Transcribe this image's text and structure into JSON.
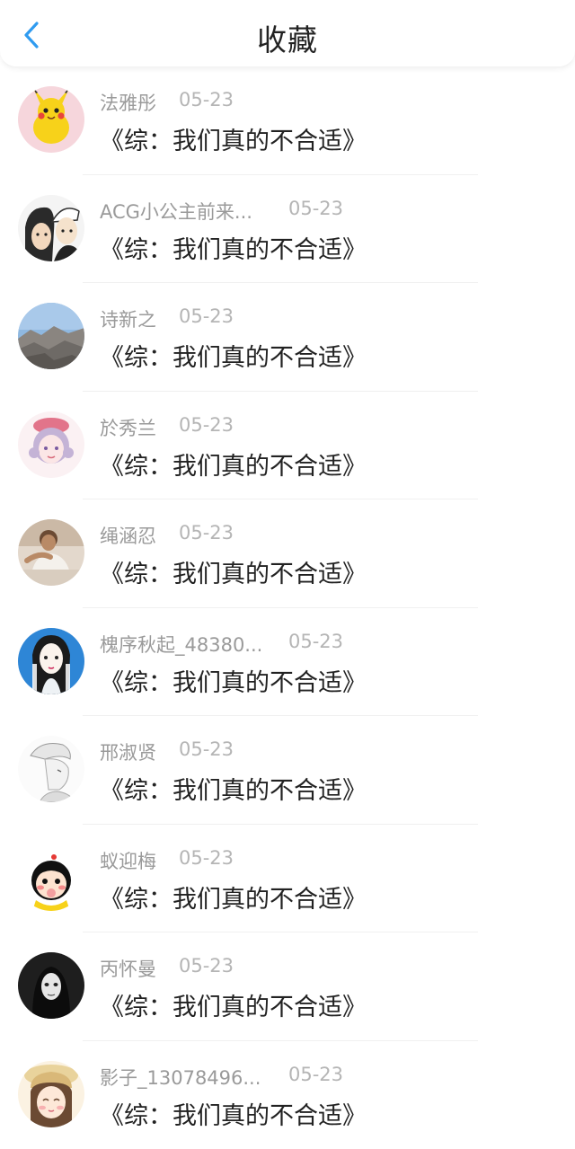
{
  "header": {
    "title": "收藏",
    "accent": "#2f9bf0"
  },
  "favorites": [
    {
      "user": "法雅彤",
      "date": "05-23",
      "book": "《综：我们真的不合适》",
      "avatar": "pikachu"
    },
    {
      "user": "ACG小公主前来...",
      "date": "05-23",
      "book": "《综：我们真的不合适》",
      "avatar": "anime-duo"
    },
    {
      "user": "诗新之",
      "date": "05-23",
      "book": "《综：我们真的不合适》",
      "avatar": "landscape"
    },
    {
      "user": "於秀兰",
      "date": "05-23",
      "book": "《综：我们真的不合适》",
      "avatar": "pink-girl"
    },
    {
      "user": "绳涵忍",
      "date": "05-23",
      "book": "《综：我们真的不合适》",
      "avatar": "man-photo"
    },
    {
      "user": "槐序秋起_48380...",
      "date": "05-23",
      "book": "《综：我们真的不合适》",
      "avatar": "anime-girl-blue"
    },
    {
      "user": "邢淑贤",
      "date": "05-23",
      "book": "《综：我们真的不合适》",
      "avatar": "sketch-boy"
    },
    {
      "user": "蚁迎梅",
      "date": "05-23",
      "book": "《综：我们真的不合适》",
      "avatar": "cartoon-kid"
    },
    {
      "user": "丙怀曼",
      "date": "05-23",
      "book": "《综：我们真的不合适》",
      "avatar": "dark-mask"
    },
    {
      "user": "影子_13078496...",
      "date": "05-23",
      "book": "《综：我们真的不合适》",
      "avatar": "girl-hat"
    }
  ]
}
